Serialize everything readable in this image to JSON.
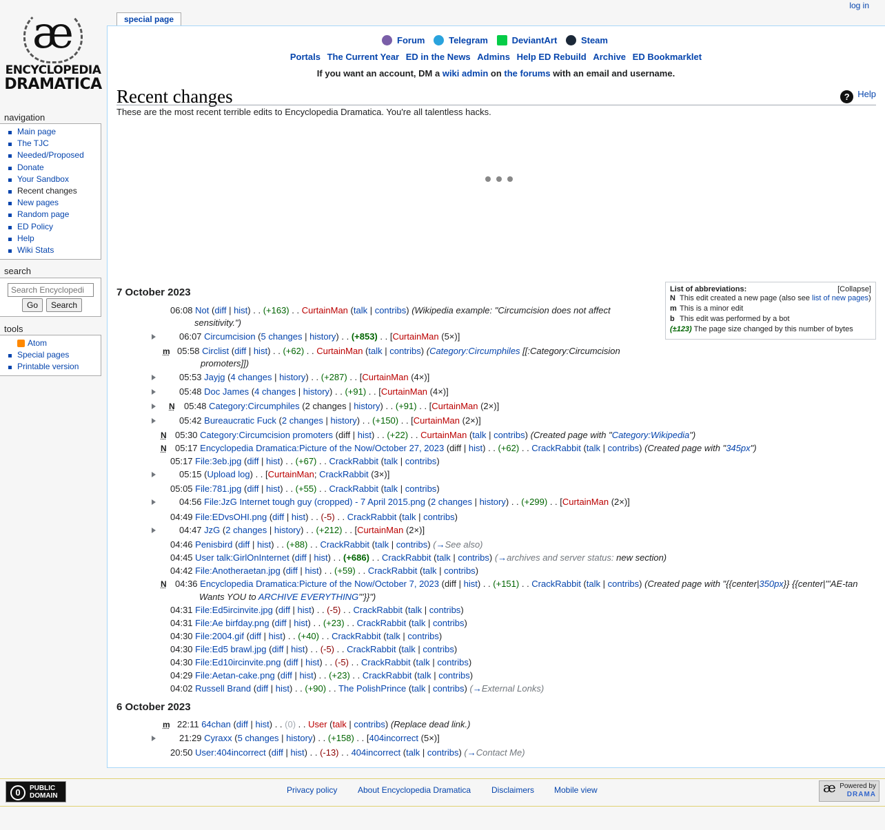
{
  "logo": {
    "glyph": "æ",
    "line1": "ENCYCLOPEDIA",
    "line2": "DRAMATICA"
  },
  "tab": "special page",
  "login": "log in",
  "nav": {
    "heading": "navigation",
    "items": [
      "Main page",
      "The TJC",
      "Needed/Proposed",
      "Donate",
      "Your Sandbox",
      "Recent changes",
      "New pages",
      "Random page",
      "ED Policy",
      "Help",
      "Wiki Stats"
    ]
  },
  "search": {
    "heading": "search",
    "placeholder": "Search Encyclopedi",
    "go": "Go",
    "search": "Search"
  },
  "tools": {
    "heading": "tools",
    "items": [
      "Atom",
      "Special pages",
      "Printable version"
    ]
  },
  "top": {
    "social": [
      "Forum",
      "Telegram",
      "DeviantArt",
      "Steam"
    ],
    "links": [
      "Portals",
      "The Current Year",
      "ED in the News",
      "Admins",
      "Help ED Rebuild",
      "Archive",
      "ED Bookmarklet"
    ],
    "account": {
      "pre": "If you want an account, DM a ",
      "link1": "wiki admin",
      "mid": " on ",
      "link2": "the forums",
      "post": " with an email and username."
    }
  },
  "title": "Recent changes",
  "help": "Help",
  "intro": "These are the most recent terrible edits to Encyclopedia Dramatica. You're all talentless hacks.",
  "legend": {
    "title": "List of abbreviations:",
    "collapse": "[Collapse]",
    "n_key": "N",
    "n_text": "This edit created a new page (also see ",
    "n_link": "list of new pages",
    "n_end": ")",
    "m_key": "m",
    "m_text": "This is a minor edit",
    "b_key": "b",
    "b_text": "This edit was performed by a bot",
    "size_key": "(±123)",
    "size_text": "The page size changed by this number of bytes"
  },
  "days": [
    "7 October 2023",
    "6 October 2023"
  ],
  "footer": {
    "links": [
      "Privacy policy",
      "About Encyclopedia Dramatica",
      "Disclaimers",
      "Mobile view"
    ],
    "pd1": "PUBLIC",
    "pd2": "DOMAIN",
    "powered": "Powered by",
    "drama": "DRAMA"
  },
  "colors": {
    "link": "#0645ad",
    "redlink": "#ba0000",
    "positive": "#006400",
    "negative": "#8b0000",
    "content_border": "#a7d7f9"
  }
}
